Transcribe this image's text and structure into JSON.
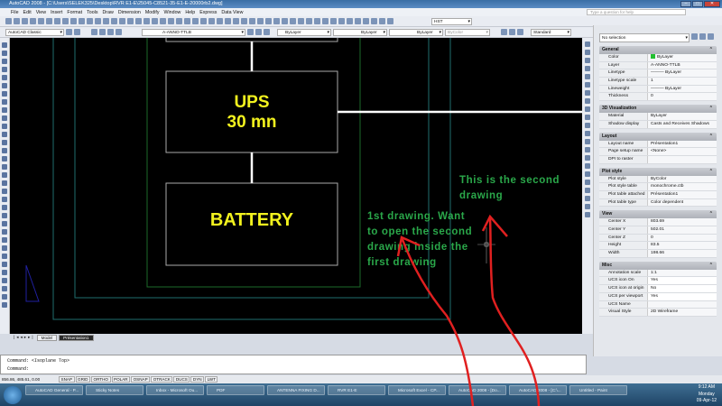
{
  "window": {
    "title": "AutoCAD 2008 - [C:\\Users\\SELEK325\\Desktop\\RVR E1-E\\25045-C8521-35-E1-E-20000rb2.dwg]"
  },
  "menu": [
    "File",
    "Edit",
    "View",
    "Insert",
    "Format",
    "Tools",
    "Draw",
    "Dimension",
    "Modify",
    "Window",
    "Help",
    "Express",
    "Data View"
  ],
  "help_placeholder": "Type a question for help",
  "toolbar": {
    "workspace": "AutoCAD Classic",
    "layer": "A-ANNO-TTLB",
    "color": "ByLayer",
    "linetype": "ByLayer",
    "lineweight": "ByLayer",
    "plotstyle": "ByColor",
    "textstyle": "HST",
    "dimstyle": "Standard"
  },
  "drawing": {
    "ups_line1": "UPS",
    "ups_line2": "30 mn",
    "battery": "BATTERY"
  },
  "annotations": {
    "second": [
      "This is the second",
      "drawing"
    ],
    "first": [
      "1st drawing. Want",
      "to open the second",
      "drawing inside the",
      "first drawing"
    ],
    "arrow_color": "#e02020",
    "text_color": "#2aa84a"
  },
  "layout_tabs": [
    "Model",
    "Présentation1"
  ],
  "command": {
    "line1": "Command:  <Isoplane Top>",
    "line2": "Command:"
  },
  "status": {
    "coords": "856.86, 485.61, 0.00",
    "buttons": [
      "SNAP",
      "GRID",
      "ORTHO",
      "POLAR",
      "OSNAP",
      "OTRACK",
      "DUCS",
      "DYN",
      "LWT"
    ]
  },
  "properties": {
    "selection": "No selection",
    "sections": [
      {
        "title": "General",
        "rows": [
          [
            "Color",
            "ByLayer"
          ],
          [
            "Layer",
            "A-ANNO-TTLB"
          ],
          [
            "Linetype",
            "——— ByLayer"
          ],
          [
            "Linetype scale",
            "1"
          ],
          [
            "Lineweight",
            "——— ByLayer"
          ],
          [
            "Thickness",
            "0"
          ]
        ]
      },
      {
        "title": "3D Visualization",
        "rows": [
          [
            "Material",
            "ByLayer"
          ],
          [
            "Shadow display",
            "Casts and Receives Shadows"
          ]
        ]
      },
      {
        "title": "Layout",
        "rows": [
          [
            "Layout name",
            "Présentation1"
          ],
          [
            "Page setup name",
            "<None>"
          ],
          [
            "DPI to raster",
            ""
          ]
        ]
      },
      {
        "title": "Plot style",
        "rows": [
          [
            "Plot style",
            "ByColor"
          ],
          [
            "Plot style table",
            "monochrome.ctb"
          ],
          [
            "Plot table attached to",
            "Présentation1"
          ],
          [
            "Plot table type",
            "Color dependent"
          ]
        ]
      },
      {
        "title": "View",
        "rows": [
          [
            "Center X",
            "803.69"
          ],
          [
            "Center Y",
            "502.01"
          ],
          [
            "Center Z",
            "0"
          ],
          [
            "Height",
            "83.5"
          ],
          [
            "Width",
            "198.66"
          ]
        ]
      },
      {
        "title": "Misc",
        "rows": [
          [
            "Annotation scale",
            "1:1"
          ],
          [
            "UCS icon On",
            "Yes"
          ],
          [
            "UCS icon at origin",
            "No"
          ],
          [
            "UCS per viewport",
            "Yes"
          ],
          [
            "UCS Name",
            ""
          ],
          [
            "Visual Style",
            "2D Wireframe"
          ]
        ]
      }
    ]
  },
  "taskbar": {
    "items": [
      "AutoCAD General - P...",
      "Sticky Notes",
      "Inbox - Microsoft Ou...",
      "PDF",
      "ANTENNA FIXING D...",
      "RVR E1-E",
      "Microsoft Excel - CP...",
      "AutoCAD 2008 - [Do...",
      "AutoCAD 2008 - [C:\\...",
      "Untitled - Paint"
    ],
    "time": "9:12 AM",
    "day": "Monday",
    "date": "09-Apr-12"
  }
}
